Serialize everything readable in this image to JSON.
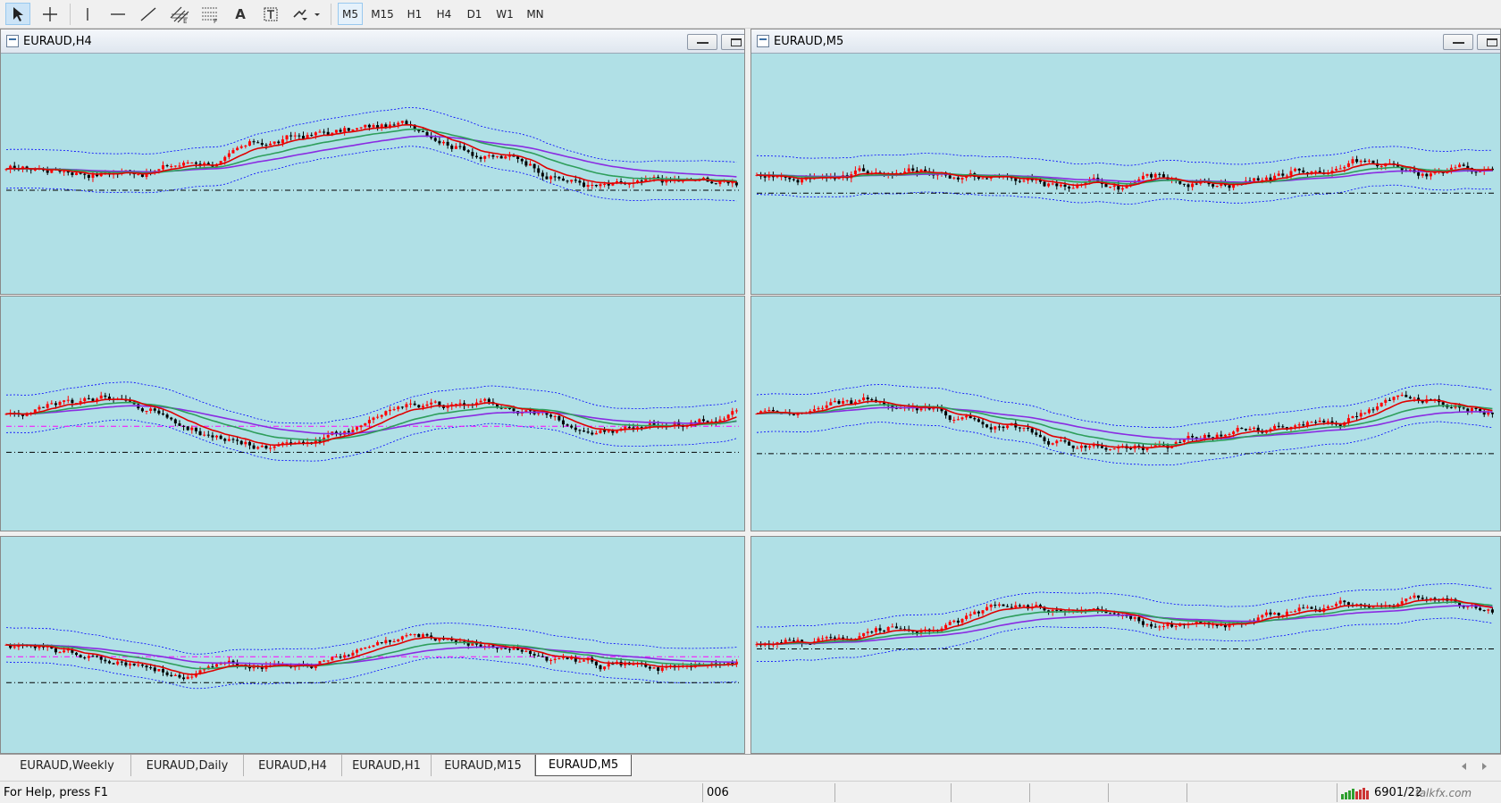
{
  "toolbar": {
    "tools": [
      {
        "name": "cursor-tool",
        "icon": "arrow-cursor-icon"
      },
      {
        "name": "crosshair-tool",
        "icon": "crosshair-icon"
      },
      {
        "name": "vertical-line-tool",
        "icon": "vertical-line-icon"
      },
      {
        "name": "horizontal-line-tool",
        "icon": "horizontal-line-icon"
      },
      {
        "name": "trendline-tool",
        "icon": "trendline-icon"
      },
      {
        "name": "channel-tool",
        "icon": "equidistant-channel-icon"
      },
      {
        "name": "fibonacci-tool",
        "icon": "fibonacci-icon"
      },
      {
        "name": "text-tool",
        "icon": "text-icon",
        "label": "A"
      },
      {
        "name": "text-label-tool",
        "icon": "text-label-icon"
      },
      {
        "name": "arrows-tool",
        "icon": "arrows-dropdown-icon"
      }
    ],
    "timeframes": [
      "M5",
      "M15",
      "H1",
      "H4",
      "D1",
      "W1",
      "MN"
    ],
    "active_timeframe": "M5"
  },
  "windows": [
    {
      "title": "EURAUD,H4",
      "has_title": true
    },
    {
      "title": "EURAUD,M5",
      "has_title": true
    },
    {
      "title": "",
      "has_title": false
    },
    {
      "title": "",
      "has_title": false
    },
    {
      "title": "",
      "has_title": false
    },
    {
      "title": "",
      "has_title": false
    }
  ],
  "colors": {
    "chart_bg": "#b0e0e6",
    "bull_candle": "#ff0000",
    "bear_candle": "#000000",
    "ma_fast": "#e00000",
    "ma_mid": "#2e9e5b",
    "ma_slow": "#8a2be2",
    "bands": "#0000ff",
    "level_line": "#000000",
    "level_line_magenta": "#ff00ff"
  },
  "tabs": [
    {
      "label": "EURAUD,Weekly",
      "active": false
    },
    {
      "label": "EURAUD,Daily",
      "active": false
    },
    {
      "label": "EURAUD,H4",
      "active": false
    },
    {
      "label": "EURAUD,H1",
      "active": false
    },
    {
      "label": "EURAUD,M15",
      "active": false
    },
    {
      "label": "EURAUD,M5",
      "active": true
    }
  ],
  "status": {
    "help": "For Help, press F1",
    "profile": "006",
    "traffic": "6901/22",
    "watermark": "talkfx.com"
  }
}
